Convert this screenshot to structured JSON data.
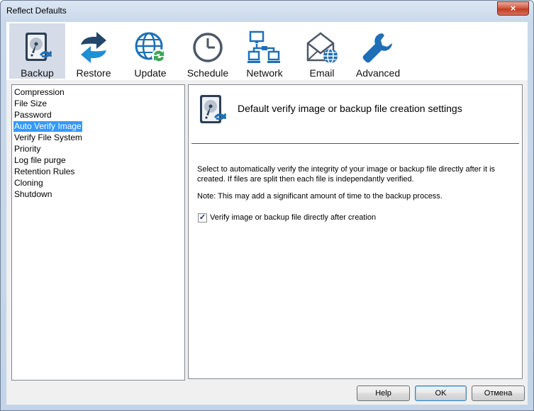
{
  "window": {
    "title": "Reflect Defaults",
    "close_glyph": "×"
  },
  "toolbar": {
    "items": [
      {
        "label": "Backup",
        "icon": "disk-backup-icon"
      },
      {
        "label": "Restore",
        "icon": "restore-arrows-icon"
      },
      {
        "label": "Update",
        "icon": "globe-update-icon"
      },
      {
        "label": "Schedule",
        "icon": "clock-icon"
      },
      {
        "label": "Network",
        "icon": "network-computers-icon"
      },
      {
        "label": "Email",
        "icon": "envelope-globe-icon"
      },
      {
        "label": "Advanced",
        "icon": "wrench-icon"
      }
    ],
    "active": "Backup"
  },
  "nav": {
    "items": [
      "Compression",
      "File Size",
      "Password",
      "Auto Verify Image",
      "Verify File System",
      "Priority",
      "Log file purge",
      "Retention Rules",
      "Cloning",
      "Shutdown"
    ],
    "selected": "Auto Verify Image"
  },
  "panel": {
    "heading": "Default verify image or backup file creation settings",
    "description": "Select to automatically verify the integrity of your image or backup file directly after it is created. If files are split then each file is independantly verified.",
    "note": "Note: This may add a significant amount of time to the backup process.",
    "checkbox": {
      "label": "Verify image or backup file directly after creation",
      "checked": true,
      "check_glyph": "✓"
    }
  },
  "buttons": {
    "help": "Help",
    "ok": "OK",
    "cancel": "Отмена"
  },
  "colors": {
    "accent": "#3399ff",
    "icon_blue": "#1f6fb6",
    "icon_dark": "#23476b",
    "icon_green": "#3aa655"
  }
}
